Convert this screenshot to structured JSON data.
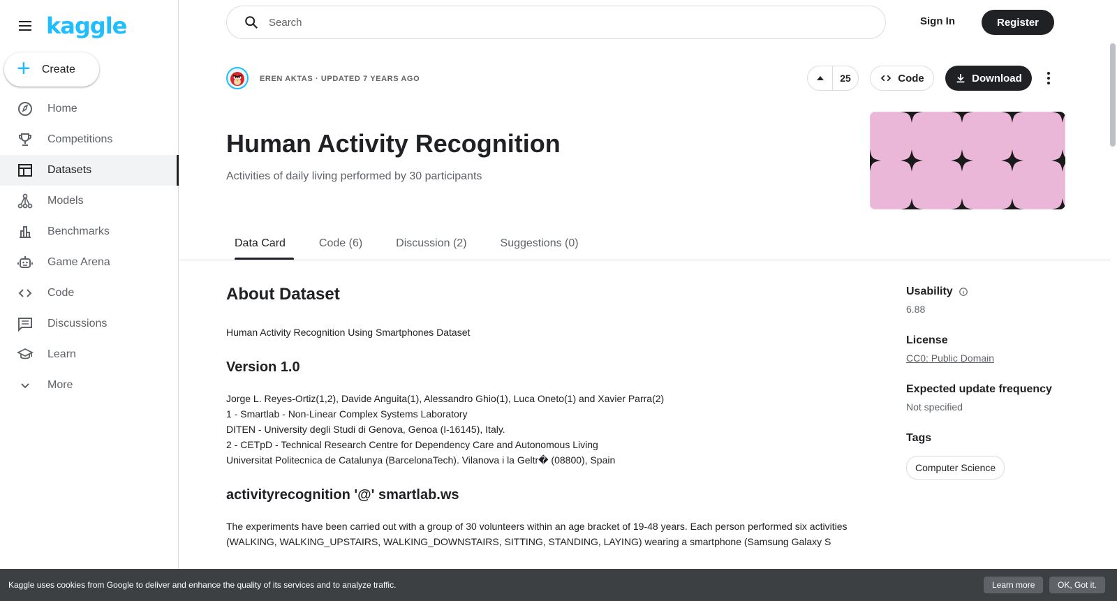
{
  "brand": {
    "logo_text": "kaggle",
    "accent": "#20beff"
  },
  "sidebar": {
    "create_label": "Create",
    "items": [
      {
        "label": "Home",
        "icon": "compass-icon"
      },
      {
        "label": "Competitions",
        "icon": "trophy-icon"
      },
      {
        "label": "Datasets",
        "icon": "table-icon",
        "active": true
      },
      {
        "label": "Models",
        "icon": "models-icon"
      },
      {
        "label": "Benchmarks",
        "icon": "bar-chart-icon"
      },
      {
        "label": "Game Arena",
        "icon": "robot-icon"
      },
      {
        "label": "Code",
        "icon": "code-icon"
      },
      {
        "label": "Discussions",
        "icon": "discussion-icon"
      },
      {
        "label": "Learn",
        "icon": "graduation-cap-icon"
      },
      {
        "label": "More",
        "icon": "chevron-down-icon"
      }
    ]
  },
  "header": {
    "search_placeholder": "Search",
    "sign_in": "Sign In",
    "register": "Register"
  },
  "dataset": {
    "meta": "EREN AKTAS · UPDATED 7 YEARS AGO",
    "votes": "25",
    "code_label": "Code",
    "download_label": "Download",
    "title": "Human Activity Recognition",
    "subtitle": "Activities of daily living performed by 30 participants",
    "cover_color": "#ebb7d8"
  },
  "tabs": [
    "Data Card",
    "Code (6)",
    "Discussion (2)",
    "Suggestions (0)"
  ],
  "content": {
    "about_heading": "About Dataset",
    "intro": "Human Activity Recognition Using Smartphones Dataset",
    "version_heading": "Version 1.0",
    "authors": [
      "Jorge L. Reyes-Ortiz(1,2), Davide Anguita(1), Alessandro Ghio(1), Luca Oneto(1) and Xavier Parra(2)",
      "1 - Smartlab - Non-Linear Complex Systems Laboratory",
      "DITEN - University degli Studi di Genova, Genoa (I-16145), Italy.",
      "2 - CETpD - Technical Research Centre for Dependency Care and Autonomous Living",
      "Universitat Politecnica de Catalunya (BarcelonaTech). Vilanova i la Geltr� (08800), Spain"
    ],
    "contact_heading": "activityrecognition '@' smartlab.ws",
    "description": "The experiments have been carried out with a group of 30 volunteers within an age bracket of 19-48 years. Each person performed six activities (WALKING, WALKING_UPSTAIRS, WALKING_DOWNSTAIRS, SITTING, STANDING, LAYING) wearing a smartphone (Samsung Galaxy S"
  },
  "side": {
    "usability_label": "Usability",
    "usability_value": "6.88",
    "license_label": "License",
    "license_value": "CC0: Public Domain",
    "frequency_label": "Expected update frequency",
    "frequency_value": "Not specified",
    "tags_label": "Tags",
    "tags": [
      "Computer Science"
    ]
  },
  "cookie": {
    "text": "Kaggle uses cookies from Google to deliver and enhance the quality of its services and to analyze traffic.",
    "learn_more": "Learn more",
    "ok": "OK, Got it."
  }
}
